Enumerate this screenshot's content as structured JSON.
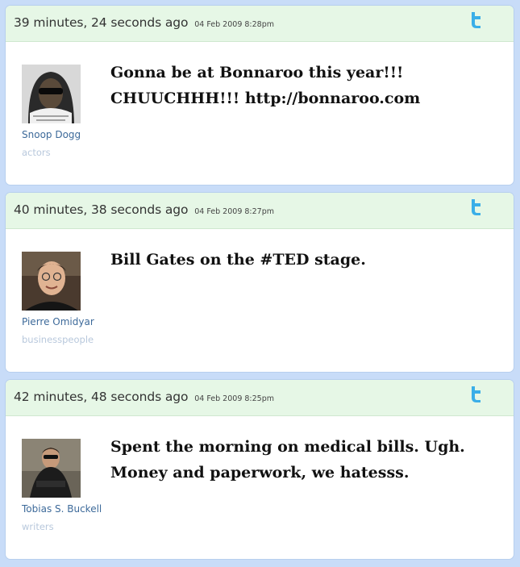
{
  "feed": {
    "items": [
      {
        "time_relative": "39 minutes, 24 seconds ago",
        "time_absolute": "04 Feb 2009 8:28pm",
        "author": "Snoop Dogg",
        "category": "actors",
        "tweet": "Gonna be at Bonnaroo this year!!! CHUUCHHH!!! http://bonnaroo.com",
        "source_icon": "twitter-icon"
      },
      {
        "time_relative": "40 minutes, 38 seconds ago",
        "time_absolute": "04 Feb 2009 8:27pm",
        "author": "Pierre Omidyar",
        "category": "businesspeople",
        "tweet": "Bill Gates on the #TED stage.",
        "source_icon": "twitter-icon"
      },
      {
        "time_relative": "42 minutes, 48 seconds ago",
        "time_absolute": "04 Feb 2009 8:25pm",
        "author": "Tobias S. Buckell",
        "category": "writers",
        "tweet": "Spent the morning on medical bills. Ugh. Money and paperwork, we hatesss.",
        "source_icon": "twitter-icon"
      }
    ]
  },
  "colors": {
    "page_background": "#c8dcf8",
    "header_background": "#e6f7e6",
    "author_link": "#3d6a9a",
    "category_link": "#b8c8dc",
    "twitter_blue": "#3aaee8"
  }
}
